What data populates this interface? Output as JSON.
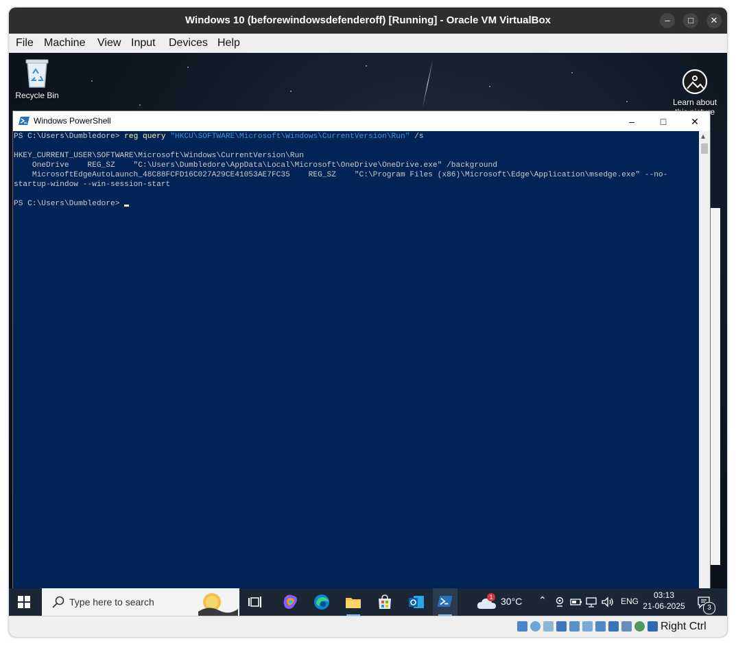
{
  "vbox": {
    "title": "Windows 10 (beforewindowsdefenderoff) [Running] - Oracle VM VirtualBox",
    "menu": [
      "File",
      "Machine",
      "View",
      "Input",
      "Devices",
      "Help"
    ],
    "status": {
      "host_key": "Right Ctrl"
    }
  },
  "desktop": {
    "icons": [
      {
        "label": "Recycle Bin",
        "icon": "recycle-bin-icon"
      },
      {
        "label": "Learn about this picture",
        "icon": "learn-about-picture-icon"
      }
    ]
  },
  "powershell": {
    "title": "Windows PowerShell",
    "prompt": "PS C:\\Users\\Dumbledore> ",
    "command": "reg query",
    "command_arg": "\"HKCU\\SOFTWARE\\Microsoft\\Windows\\CurrentVersion\\Run\"",
    "command_flag": " /s",
    "output": [
      "",
      "HKEY_CURRENT_USER\\SOFTWARE\\Microsoft\\Windows\\CurrentVersion\\Run",
      "    OneDrive    REG_SZ    \"C:\\Users\\Dumbledore\\AppData\\Local\\Microsoft\\OneDrive\\OneDrive.exe\" /background",
      "    MicrosoftEdgeAutoLaunch_48C88FCFD16C027A29CE41053AE7FC35    REG_SZ    \"C:\\Program Files (x86)\\Microsoft\\Edge\\Application\\msedge.exe\" --no-",
      "startup-window --win-session-start",
      ""
    ],
    "final_prompt": "PS C:\\Users\\Dumbledore> "
  },
  "taskbar": {
    "search_placeholder": "Type here to search",
    "weather_temp": "30°C",
    "weather_badge": "1",
    "language": "ENG",
    "time": "03:13",
    "date": "21-06-2025",
    "notification_count": "3",
    "colors": {
      "accent": "#76b9ed",
      "taskbar_bg": "#1c2736"
    }
  },
  "colors": {
    "powershell_bg": "#012456",
    "powershell_text": "#cccccc",
    "powershell_command": "#f9f1a5",
    "powershell_string": "#3a96dd"
  }
}
